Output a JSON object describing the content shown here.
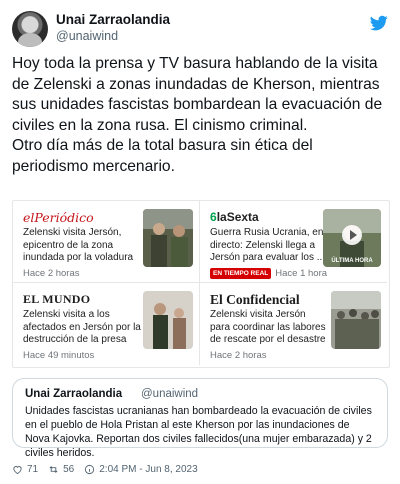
{
  "author": {
    "name": "Unai Zarraolandia",
    "handle": "@unaiwind"
  },
  "tweet": {
    "line1": "Hoy toda la prensa y TV basura hablando de la visita de Zelenski a zonas inundadas de Kherson, mientras sus unidades fascistas bombardean la evacuación de civiles en la zona rusa. El cinismo criminal.",
    "line2": "Otro día más de la total basura sin ética del periodismo mercenario."
  },
  "cards": [
    {
      "source": "elPeriódico",
      "headline": "Zelenski visita Jersón, epicentro de la zona inundada por la voladura ...",
      "age": "Hace 2 horas"
    },
    {
      "source": "laSexta",
      "headline": "Guerra Rusia Ucrania, en directo: Zelenski llega a Jersón para evaluar los ...",
      "badge": "EN TIEMPO REAL",
      "age": "Hace 1 hora",
      "thumb_label": "ÚLTIMA HORA"
    },
    {
      "source": "EL MUNDO",
      "headline": "Zelenski visita a los afectados en Jersón por la destrucción de la presa",
      "age": "Hace 49 minutos"
    },
    {
      "source": "El Confidencial",
      "headline": "Zelenski visita Jersón para coordinar las labores de rescate por el desastre de ...",
      "age": "Hace 2 horas"
    }
  ],
  "quote": {
    "name": "Unai Zarraolandia",
    "handle": "@unaiwind",
    "text": "Unidades fascistas ucranianas han bombardeado la evacuación de civiles en el pueblo de Hola Pristan al este Kherson por las inundaciones de Nova Kajovka. Reportan dos civiles fallecidos(una mujer embarazada) y 2 civiles heridos."
  },
  "footer": {
    "likes": "71",
    "retweets": "56",
    "timestamp": "2:04 PM - Jun 8, 2023"
  },
  "colors": {
    "twitter_blue": "#1d9bf0",
    "periodico_red": "#c4161c",
    "lasexta_green": "#00a14b",
    "live_red": "#d50000"
  }
}
